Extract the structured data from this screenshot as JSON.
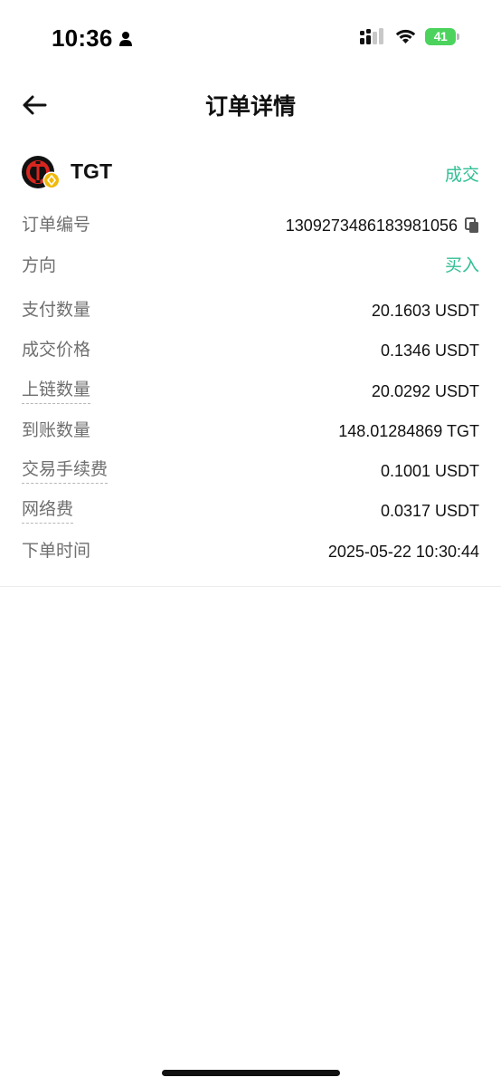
{
  "status_bar": {
    "time": "10:36",
    "battery": "41"
  },
  "nav": {
    "title": "订单详情"
  },
  "token": {
    "name": "TGT",
    "status": "成交"
  },
  "details": [
    {
      "label": "订单编号",
      "value": "1309273486183981056"
    },
    {
      "label": "方向",
      "value": "买入"
    },
    {
      "label": "支付数量",
      "value": "20.1603 USDT"
    },
    {
      "label": "成交价格",
      "value": "0.1346 USDT"
    },
    {
      "label": "上链数量",
      "value": "20.0292 USDT"
    },
    {
      "label": "到账数量",
      "value": "148.01284869 TGT"
    },
    {
      "label": "交易手续费",
      "value": "0.1001 USDT"
    },
    {
      "label": "网络费",
      "value": "0.0317 USDT"
    },
    {
      "label": "下单时间",
      "value": "2025-05-22 10:30:44"
    }
  ],
  "colors": {
    "accent_green": "#2fbf94",
    "label_gray": "#6f6f6f",
    "battery_green": "#4cd35e"
  },
  "icons": {
    "back": "arrow-left-icon",
    "copy": "copy-icon",
    "person": "person-icon",
    "signal": "cellular-signal-icon",
    "wifi": "wifi-icon",
    "battery": "battery-charging-icon"
  }
}
